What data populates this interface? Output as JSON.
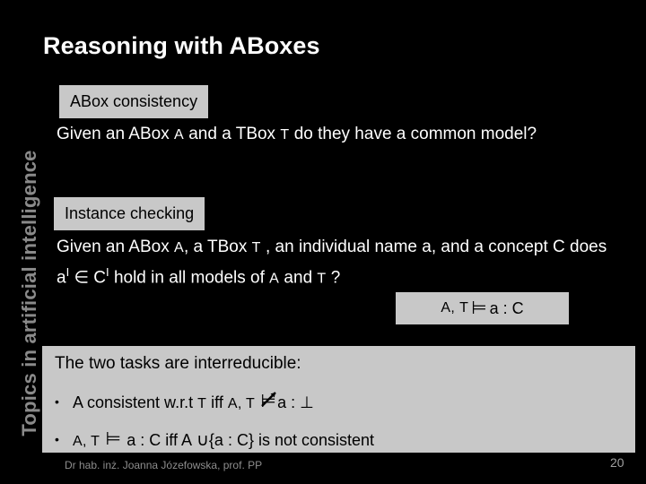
{
  "slide": {
    "background_color": "#000000",
    "panel_color": "#c8c8c8",
    "title_color": "#ffffff",
    "body_color": "#ffffff",
    "side_banner_color": "#8a8a8a",
    "title": "Reasoning with ABoxes",
    "side_banner": "Topics in artificial intelligence"
  },
  "task_consistency": {
    "chip_label": "ABox consistency",
    "text_part_1": "Given an ABox ",
    "symbol_abox": "A",
    "text_part_2": " and a TBox ",
    "symbol_tbox": "T",
    "text_part_3": " do they have a common model?"
  },
  "task_instance": {
    "chip_label": "Instance checking",
    "text_part_1": "Given an ABox ",
    "symbol_abox": "A",
    "text_part_2": ", a TBox ",
    "symbol_tbox": "T",
    "text_part_3": " , an individual name a, and a concept C does a",
    "sup_1": "I",
    "text_part_4": " ∈ C",
    "sup_2": "I",
    "text_part_5": " hold in all models of ",
    "symbol_abox_2": "A",
    "text_part_6": " and ",
    "symbol_tbox_2": "T",
    "text_part_7": " ?"
  },
  "formula_box": {
    "lhs_abox": "A,",
    "lhs_tbox": "T",
    "entails_symbol": "⊨",
    "rhs": "a : C"
  },
  "bottom_panel": {
    "heading": "The two tasks are interreducible:",
    "bullets": [
      {
        "dot": "•",
        "text_1": "A consistent w.r.t ",
        "sym_1": "T",
        "text_2": " iff ",
        "sym_2": "A, T",
        "relation": "⊨",
        "relation_name": "not-entails",
        "text_3": "a : ",
        "tail": "⊥"
      },
      {
        "dot": "•",
        "sym_1": "A, T",
        "relation": "⊨",
        "relation_name": "entails",
        "text_1": " a : C iff ",
        "sym_2": "A",
        "union": "∪",
        "text_2": "{a : C} is not consistent"
      }
    ]
  },
  "footer": {
    "author": "Dr hab. inż. Joanna Józefowska, prof. PP",
    "page_number": "20"
  }
}
